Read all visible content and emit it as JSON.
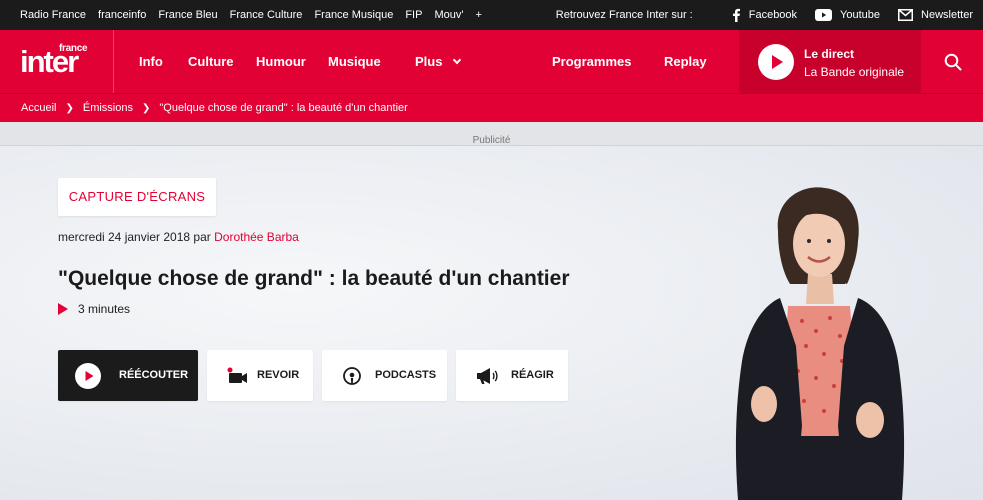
{
  "topbar": {
    "links": [
      "Radio France",
      "franceinfo",
      "France Bleu",
      "France Culture",
      "France Musique",
      "FIP",
      "Mouv'",
      "+"
    ],
    "social_label": "Retrouvez France Inter sur :",
    "social": [
      {
        "label": "Facebook",
        "icon": "facebook-icon"
      },
      {
        "label": "Youtube",
        "icon": "youtube-icon"
      },
      {
        "label": "Newsletter",
        "icon": "mail-icon"
      }
    ]
  },
  "brand": {
    "small": "france",
    "name": "inter",
    "color": "#e20134"
  },
  "nav": {
    "items": [
      "Info",
      "Culture",
      "Humour",
      "Musique",
      "Plus",
      "Programmes",
      "Replay"
    ],
    "live_title": "Le direct",
    "live_subtitle": "La Bande originale"
  },
  "breadcrumb": [
    "Accueil",
    "Émissions",
    "\"Quelque chose de grand\" : la beauté d'un chantier"
  ],
  "ad_label": "Publicité",
  "episode": {
    "show": "CAPTURE D'ÉCRANS",
    "date": "mercredi 24 janvier 2018",
    "by": "par",
    "author": "Dorothée Barba",
    "title": "\"Quelque chose de grand\" : la beauté d'un chantier",
    "duration": "3 minutes"
  },
  "actions": [
    {
      "label": "RÉÉCOUTER",
      "icon": "play-icon"
    },
    {
      "label": "REVOIR",
      "icon": "video-camera-icon"
    },
    {
      "label": "PODCASTS",
      "icon": "podcast-icon"
    },
    {
      "label": "RÉAGIR",
      "icon": "megaphone-icon"
    }
  ]
}
